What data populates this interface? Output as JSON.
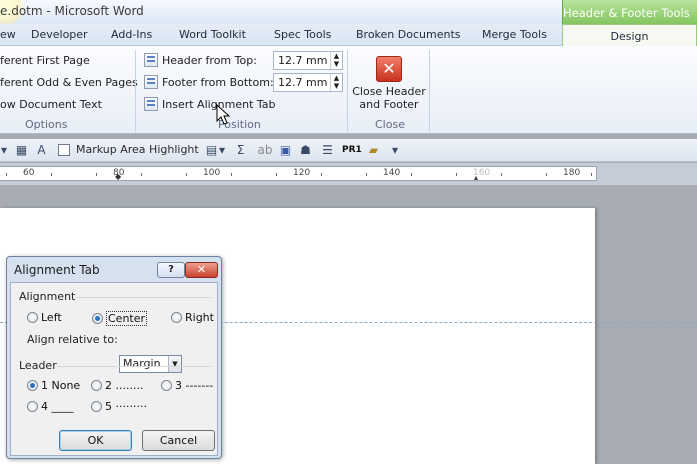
{
  "window": {
    "title": "e.dotm - Microsoft Word",
    "context_tab_group": "Header & Footer Tools"
  },
  "tabs": [
    "ew",
    "Developer",
    "Add-Ins",
    "Word Toolkit",
    "Spec Tools",
    "Broken Documents",
    "Merge Tools",
    "Design"
  ],
  "ribbon": {
    "options": {
      "items": [
        "ferent First Page",
        "ferent Odd & Even Pages",
        "ow Document Text"
      ],
      "label": "Options"
    },
    "position": {
      "header_from_top_label": "Header from Top:",
      "header_from_top_value": "12.7 mm",
      "footer_from_bottom_label": "Footer from Bottom:",
      "footer_from_bottom_value": "12.7 mm",
      "insert_alignment_tab": "Insert Alignment Tab",
      "label": "Position"
    },
    "close": {
      "button_label_line1": "Close Header",
      "button_label_line2": "and Footer",
      "label": "Close"
    }
  },
  "toolbar": {
    "markup_area_highlight": "Markup Area Highlight",
    "pr1": "PR1"
  },
  "ruler": {
    "labels": [
      "60",
      "80",
      "100",
      "120",
      "140",
      "160",
      "180"
    ]
  },
  "dialog": {
    "title": "Alignment Tab",
    "help": "?",
    "alignment_label": "Alignment",
    "alignment_options": {
      "left": "Left",
      "center": "Center",
      "right": "Right"
    },
    "selected_alignment": "Center",
    "align_relative_label": "Align relative to:",
    "align_relative_value": "Margin",
    "leader_label": "Leader",
    "leaders": {
      "l1": "1 None",
      "l2": "2 ........",
      "l3": "3 -------",
      "l4": "4 ____",
      "l5": "5 ·········"
    },
    "selected_leader": "1 None",
    "ok": "OK",
    "cancel": "Cancel"
  }
}
